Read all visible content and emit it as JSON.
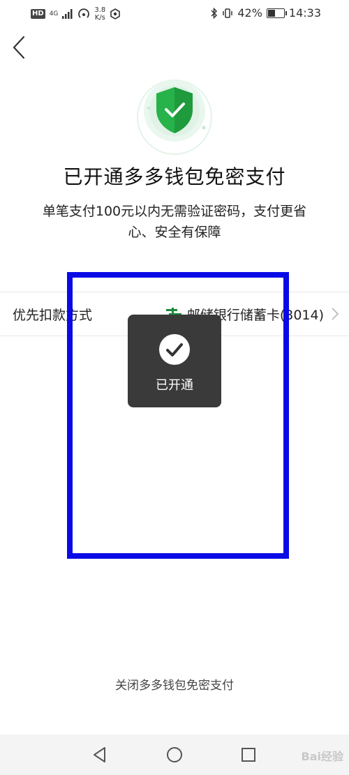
{
  "status_bar": {
    "hd": "HD",
    "network": "4G",
    "speed_value": "3.8",
    "speed_unit": "K/s",
    "battery": "42%",
    "battery_level": 0.42,
    "time": "14:33"
  },
  "header": {
    "back_icon": "chevron-left-icon"
  },
  "hero": {
    "icon": "shield-check-icon",
    "title": "已开通多多钱包免密支付",
    "description": "单笔支付100元以内无需验证密码，支付更省心、安全有保障"
  },
  "payment": {
    "label": "优先扣款方式",
    "bank_icon": "postal-bank-icon",
    "method": "邮储银行储蓄卡(3014)",
    "chevron_icon": "chevron-right-icon"
  },
  "toast": {
    "icon": "check-circle-icon",
    "text": "已开通"
  },
  "footer": {
    "close_link": "关闭多多钱包免密支付"
  },
  "nav": {
    "back_icon": "triangle-back-icon",
    "home_icon": "circle-home-icon",
    "recent_icon": "square-recent-icon",
    "watermark": "Bai经验"
  },
  "colors": {
    "shield_green": "#27b24a",
    "annotation_blue": "#0a0ae6",
    "toast_bg": "#3a3a3a",
    "bank_green": "#1a8a3c"
  }
}
